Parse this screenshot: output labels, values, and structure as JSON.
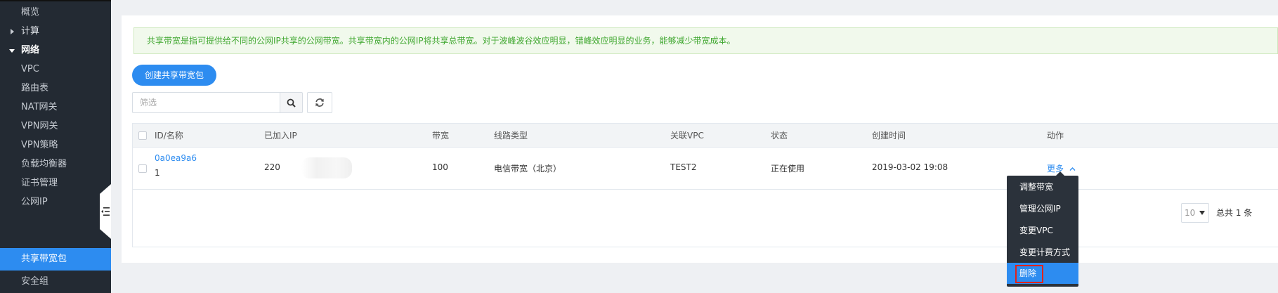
{
  "sidebar": {
    "items": [
      {
        "label": "概览"
      },
      {
        "label": "计算"
      },
      {
        "label": "网络"
      },
      {
        "label": "VPC"
      },
      {
        "label": "路由表"
      },
      {
        "label": "NAT网关"
      },
      {
        "label": "VPN网关"
      },
      {
        "label": "VPN策略"
      },
      {
        "label": "负载均衡器"
      },
      {
        "label": "证书管理"
      },
      {
        "label": "公网IP"
      },
      {
        "label": "共享带宽包"
      },
      {
        "label": "安全组"
      }
    ]
  },
  "notice": {
    "text": "共享带宽是指可提供给不同的公网IP共享的公网带宽。共享带宽内的公网IP将共享总带宽。对于波峰波谷效应明显，错峰效应明显的业务，能够减少带宽成本。"
  },
  "toolbar": {
    "create_label": "创建共享带宽包",
    "filter_placeholder": "筛选"
  },
  "table": {
    "headers": [
      "ID/名称",
      "已加入IP",
      "带宽",
      "线路类型",
      "关联VPC",
      "状态",
      "创建时间",
      "动作"
    ],
    "rows": [
      {
        "id": "0a0ea9a6",
        "name": "1",
        "ip": "220",
        "bandwidth": "100",
        "line_type": "电信带宽（北京）",
        "vpc": "TEST2",
        "status": "正在使用",
        "created": "2019-03-02 19:08",
        "action": "更多"
      }
    ]
  },
  "pagination": {
    "page_size": "10",
    "total": "总共 1 条"
  },
  "dropdown": {
    "items": [
      {
        "label": "调整带宽"
      },
      {
        "label": "管理公网IP"
      },
      {
        "label": "变更VPC"
      },
      {
        "label": "变更计费方式"
      },
      {
        "label": "删除"
      }
    ],
    "active_index": 4
  },
  "colors": {
    "primary": "#2d8cf0",
    "sidebar_bg": "#232a33",
    "notice_text": "#3fa72f",
    "highlight": "#e2231a"
  }
}
